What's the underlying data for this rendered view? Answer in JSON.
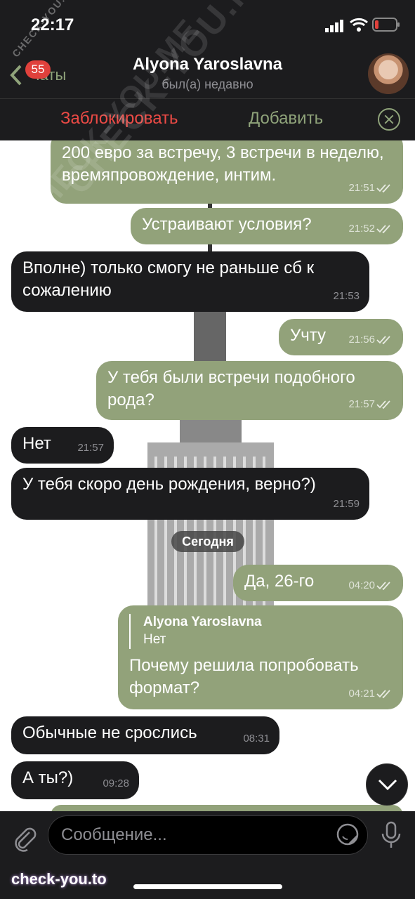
{
  "status_bar": {
    "time": "22:17"
  },
  "header": {
    "back_label": "Чаты",
    "unread_count": "55",
    "contact_name": "Alyona Yaroslavna",
    "contact_status": "был(а) недавно"
  },
  "action_bar": {
    "block_label": "Заблокировать",
    "add_label": "Добавить"
  },
  "messages": [
    {
      "dir": "out",
      "text": "200 евро за встречу, 3 встречи в неделю, времяпровождение, интим.",
      "time": "21:51"
    },
    {
      "dir": "out",
      "text": "Устраивают условия?",
      "time": "21:52"
    },
    {
      "dir": "in",
      "text": "Вполне) только смогу не раньше сб к сожалению",
      "time": "21:53"
    },
    {
      "dir": "out",
      "text": "Учту",
      "time": "21:56"
    },
    {
      "dir": "out",
      "text": "У тебя были встречи подобного рода?",
      "time": "21:57"
    },
    {
      "dir": "in",
      "text": "Нет",
      "time": "21:57"
    },
    {
      "dir": "in",
      "text": "У тебя скоро день рождения, верно?)",
      "time": "21:59"
    },
    {
      "dir": "out",
      "text": "Да, 26-го",
      "time": "04:20"
    },
    {
      "dir": "out",
      "text": "Почему решила попробовать формат?",
      "time": "04:21",
      "reply_author": "Alyona Yaroslavna",
      "reply_text": "Нет"
    },
    {
      "dir": "in",
      "text": "Обычные не срослись",
      "time": "08:31"
    },
    {
      "dir": "in",
      "text": "А ты?)",
      "time": "09:28"
    }
  ],
  "day_separator": "Сегодня",
  "composer": {
    "placeholder": "Сообщение..."
  },
  "watermark": {
    "bottom": "check-you.to",
    "diagonal_1": "CHECK-YOU.ME",
    "diagonal_2": "CHECK-YOU.ME",
    "diagonal_3": "CHECK-YOU.ME"
  },
  "colors": {
    "accent": "#8fa37a",
    "outgoing_bubble": "#92a27a",
    "incoming_bubble": "#1c1c1e",
    "danger": "#ec4a45"
  }
}
